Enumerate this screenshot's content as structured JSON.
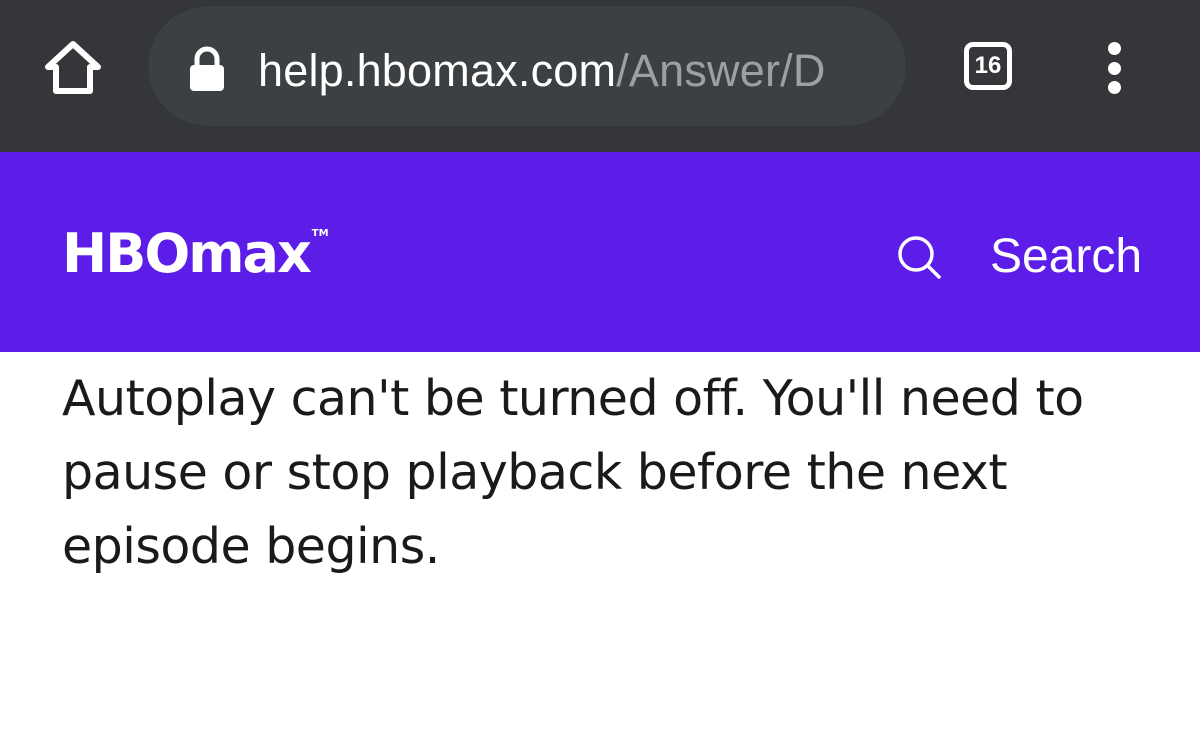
{
  "browser": {
    "url_domain": "help.hbomax.com",
    "url_path": "/Answer/D",
    "tab_count": "16",
    "icons": {
      "home": "home-icon",
      "lock": "lock-icon",
      "menu": "more-vert-icon"
    }
  },
  "header": {
    "logo_text": "HBOmax",
    "logo_tm": "TM",
    "search_label": "Search",
    "brand_color": "#5c1de8"
  },
  "article": {
    "body": "Autoplay can't be turned off. You'll need to pause or stop playback before the next episode begins."
  }
}
